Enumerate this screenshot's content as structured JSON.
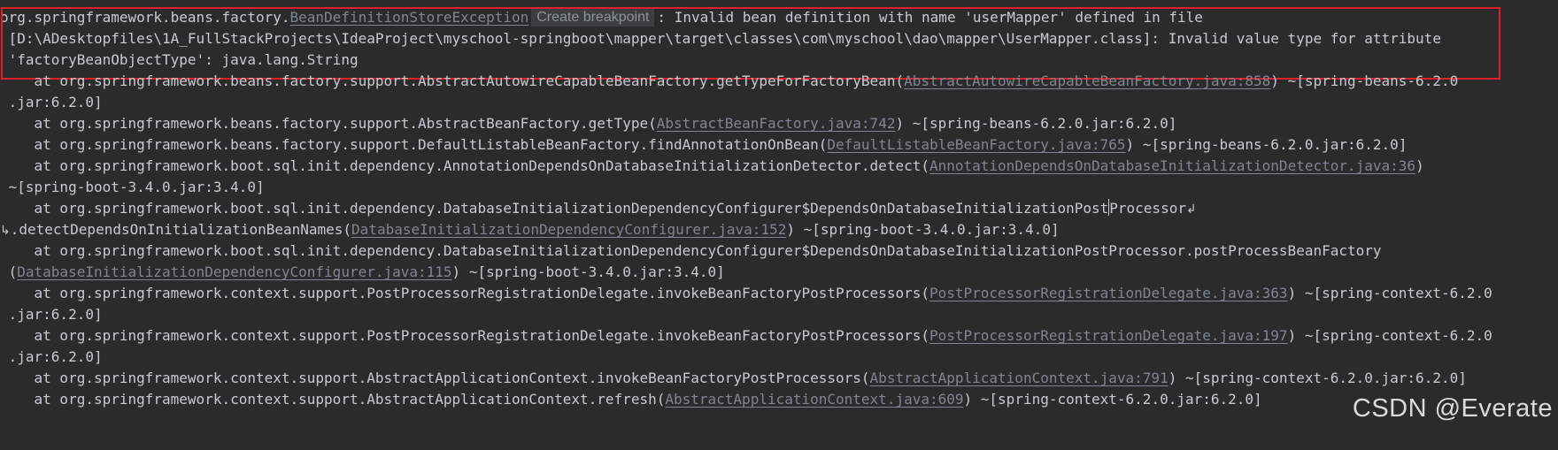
{
  "console": {
    "exception_prefix": "org.springframework.beans.factory.",
    "exception_link": "BeanDefinitionStoreException",
    "tooltip_create_breakpoint": "Create breakpoint",
    "exception_message_1": ": Invalid bean definition with name 'userMapper' defined in file",
    "exception_message_2": " [D:\\ADesktopfiles\\1A_FullStackProjects\\IdeaProject\\myschool-springboot\\mapper\\target\\classes\\com\\myschool\\dao\\mapper\\UserMapper.class]: Invalid value type for attribute",
    "exception_message_3": " 'factoryBeanObjectType': java.lang.String",
    "lines": [
      {
        "pre": "    at org.springframework.beans.factory.support.AbstractAutowireCapableBeanFactory.getTypeForFactoryBean(",
        "link": "AbstractAutowireCapableBeanFactory.java:858",
        "post": ") ~[spring-beans-6.2.0"
      },
      {
        "pre": " .jar:6.2.0]",
        "link": "",
        "post": ""
      },
      {
        "pre": "    at org.springframework.beans.factory.support.AbstractBeanFactory.getType(",
        "link": "AbstractBeanFactory.java:742",
        "post": ") ~[spring-beans-6.2.0.jar:6.2.0]"
      },
      {
        "pre": "    at org.springframework.beans.factory.support.DefaultListableBeanFactory.findAnnotationOnBean(",
        "link": "DefaultListableBeanFactory.java:765",
        "post": ") ~[spring-beans-6.2.0.jar:6.2.0]"
      },
      {
        "pre": "    at org.springframework.boot.sql.init.dependency.AnnotationDependsOnDatabaseInitializationDetector.detect(",
        "link": "AnnotationDependsOnDatabaseInitializationDetector.java:36",
        "post": ")"
      },
      {
        "pre": " ~[spring-boot-3.4.0.jar:3.4.0]",
        "link": "",
        "post": ""
      },
      {
        "pre": "    at org.springframework.boot.sql.init.dependency.DatabaseInitializationDependencyConfigurer$DependsOnDatabaseInitializationPost",
        "link": "",
        "post": "Processor"
      },
      {
        "pre": ".detectDependsOnInitializationBeanNames(",
        "link": "DatabaseInitializationDependencyConfigurer.java:152",
        "post": ") ~[spring-boot-3.4.0.jar:3.4.0]"
      },
      {
        "pre": "    at org.springframework.boot.sql.init.dependency.DatabaseInitializationDependencyConfigurer$DependsOnDatabaseInitializationPostProcessor.postProcessBeanFactory",
        "link": "",
        "post": ""
      },
      {
        "pre": " (",
        "link": "DatabaseInitializationDependencyConfigurer.java:115",
        "post": ") ~[spring-boot-3.4.0.jar:3.4.0]"
      },
      {
        "pre": "    at org.springframework.context.support.PostProcessorRegistrationDelegate.invokeBeanFactoryPostProcessors(",
        "link": "PostProcessorRegistrationDelegate.java:363",
        "post": ") ~[spring-context-6.2.0"
      },
      {
        "pre": " .jar:6.2.0]",
        "link": "",
        "post": ""
      },
      {
        "pre": "    at org.springframework.context.support.PostProcessorRegistrationDelegate.invokeBeanFactoryPostProcessors(",
        "link": "PostProcessorRegistrationDelegate.java:197",
        "post": ") ~[spring-context-6.2.0"
      },
      {
        "pre": " .jar:6.2.0]",
        "link": "",
        "post": ""
      },
      {
        "pre": "    at org.springframework.context.support.AbstractApplicationContext.invokeBeanFactoryPostProcessors(",
        "link": "AbstractApplicationContext.java:791",
        "post": ") ~[spring-context-6.2.0.jar:6.2.0]"
      },
      {
        "pre": "    at org.springframework.context.support.AbstractApplicationContext.refresh(",
        "link": "AbstractApplicationContext.java:609",
        "post": ") ~[spring-context-6.2.0.jar:6.2.0]"
      }
    ]
  },
  "watermark": "CSDN @Everate",
  "colors": {
    "background": "#2b2b2b",
    "text": "#c7cbd1",
    "link": "#7f8593",
    "highlight_border": "#e0202b"
  }
}
